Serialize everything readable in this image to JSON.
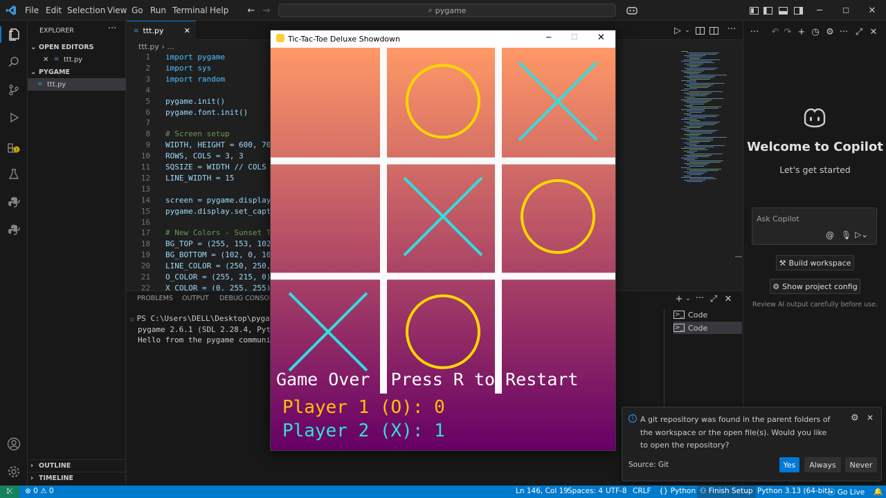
{
  "menu": [
    "File",
    "Edit",
    "Selection",
    "View",
    "Go",
    "Run",
    "Terminal",
    "Help"
  ],
  "search": {
    "text": "pygame"
  },
  "sidebar": {
    "header": "EXPLORER",
    "open_editors": "OPEN EDITORS",
    "open_file": "ttt.py",
    "folder": "PYGAME",
    "file": "ttt.py",
    "outline": "OUTLINE",
    "timeline": "TIMELINE"
  },
  "tab": {
    "label": "ttt.py",
    "breadcrumb_file": "ttt.py",
    "breadcrumb_rest": "..."
  },
  "code_lines": [
    {
      "n": "1",
      "t": "import pygame"
    },
    {
      "n": "2",
      "t": "import sys"
    },
    {
      "n": "3",
      "t": "import random"
    },
    {
      "n": "4",
      "t": ""
    },
    {
      "n": "5",
      "t": "pygame.init()"
    },
    {
      "n": "6",
      "t": "pygame.font.init()"
    },
    {
      "n": "7",
      "t": ""
    },
    {
      "n": "8",
      "t": "# Screen setup"
    },
    {
      "n": "9",
      "t": "WIDTH, HEIGHT = 600, 700"
    },
    {
      "n": "10",
      "t": "ROWS, COLS = 3, 3"
    },
    {
      "n": "11",
      "t": "SQSIZE = WIDTH // COLS"
    },
    {
      "n": "12",
      "t": "LINE_WIDTH = 15"
    },
    {
      "n": "13",
      "t": ""
    },
    {
      "n": "14",
      "t": "screen = pygame.display."
    },
    {
      "n": "15",
      "t": "pygame.display.set_capti"
    },
    {
      "n": "16",
      "t": ""
    },
    {
      "n": "17",
      "t": "# New Colors - Sunset Th"
    },
    {
      "n": "18",
      "t": "BG_TOP = (255, 153, 102)"
    },
    {
      "n": "19",
      "t": "BG_BOTTOM = (102, 0, 102"
    },
    {
      "n": "20",
      "t": "LINE_COLOR = (250, 250,"
    },
    {
      "n": "21",
      "t": "O_COLOR = (255, 215, 0)"
    },
    {
      "n": "22",
      "t": "X_COLOR = (0, 255, 255)"
    }
  ],
  "panel": {
    "tabs": [
      "PROBLEMS",
      "OUTPUT",
      "DEBUG CONSOLE"
    ],
    "terminal": [
      "PS C:\\Users\\DELL\\Desktop\\pygame>",
      "pygame 2.6.1 (SDL 2.28.4, Python",
      "Hello from the pygame community."
    ],
    "terminals": [
      "Code",
      "Code"
    ]
  },
  "copilot": {
    "title": "Welcome to Copilot",
    "subtitle": "Let's get started",
    "placeholder": "Ask Copilot",
    "build": "Build workspace",
    "config": "Show project config",
    "disclaimer": "Review AI output carefully before use."
  },
  "game": {
    "window_title": "Tic-Tac-Toe Deluxe Showdown",
    "board": [
      "",
      "O",
      "X",
      "",
      "X",
      "O",
      "X",
      "O",
      ""
    ],
    "overlay_text": "Game Over  Press R to Restart",
    "score_p1": "Player 1 (O): 0",
    "score_p2": "Player 2 (X): 1",
    "colors": {
      "bg_top": "#ff9966",
      "bg_bottom": "#660066",
      "line": "#fafafa",
      "o": "#ffd700",
      "x": "#33dddd",
      "text": "#ffffff",
      "p1": "#ffc107",
      "p2": "#33dddd"
    }
  },
  "notification": {
    "message": "A git repository was found in the parent folders of the workspace or the open file(s). Would you like to open the repository?",
    "source": "Source: Git",
    "yes": "Yes",
    "always": "Always",
    "never": "Never"
  },
  "status": {
    "errors": "0",
    "warnings": "0",
    "position": "Ln 146, Col 19",
    "spaces": "Spaces: 4",
    "encoding": "UTF-8",
    "eol": "CRLF",
    "language": "Python",
    "finish": "Finish Setup",
    "interpreter": "Python 3.13 (64-bit)",
    "golive": "Go Live"
  }
}
